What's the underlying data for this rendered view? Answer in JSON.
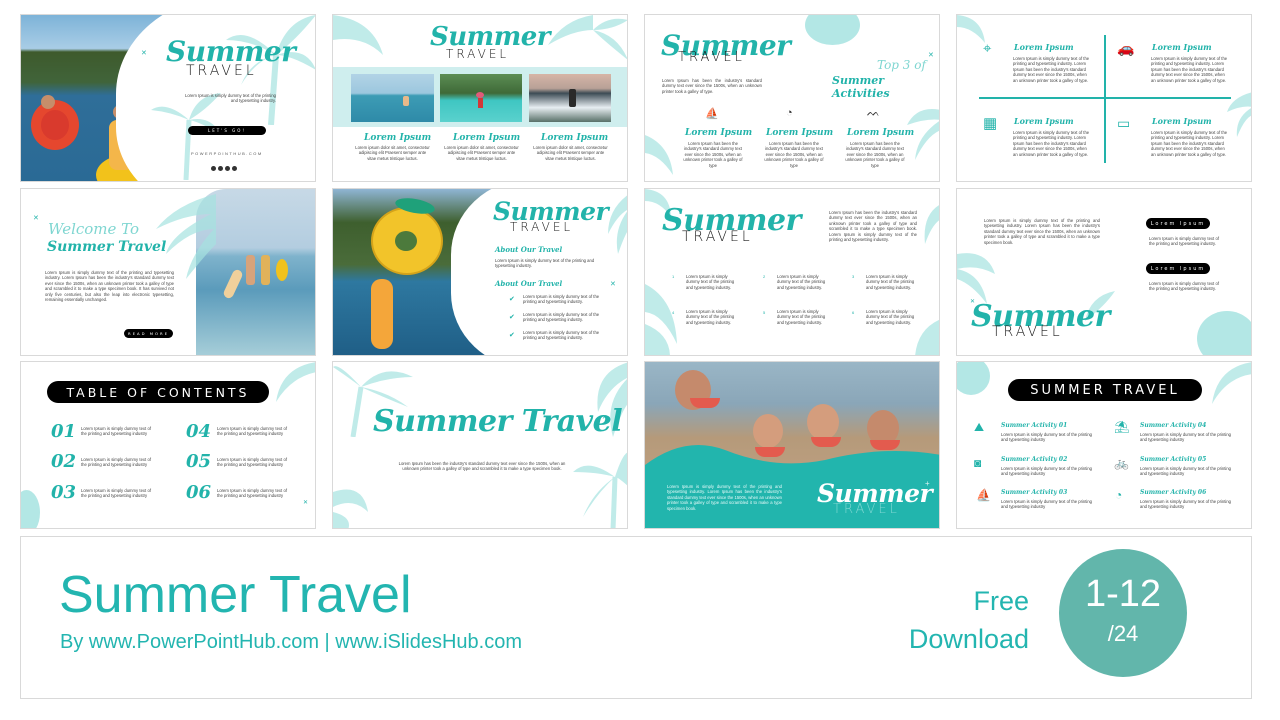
{
  "banner": {
    "title": "Summer Travel",
    "subtitle": "By www.PowerPointHub.com | www.iSlidesHub.com",
    "free_line1": "Free",
    "free_line2": "Download",
    "badge_range": "1-12",
    "badge_total": "/24"
  },
  "colors": {
    "accent": "#22b3aa",
    "badge": "#62b6ab",
    "leaf": "#a6e3e0",
    "pill": "#000000"
  },
  "slides": [
    {
      "script": "Summer",
      "travel": "TRAVEL",
      "desc": "Lorem Ipsum is simply dummy text of the printing and typesetting industry.",
      "button": "LET'S GO!",
      "website": "POWERPOINTHUB.COM",
      "social_icons": [
        "instagram-icon",
        "facebook-icon",
        "twitter-icon",
        "pinterest-icon"
      ]
    },
    {
      "script": "Summer",
      "travel": "TRAVEL",
      "cards": [
        {
          "title": "Lorem Ipsum",
          "text": "Lorem ipsum dolor sit amet, consectetur adipiscing elit Praesent semper ante vitae metus tristique luctus."
        },
        {
          "title": "Lorem Ipsum",
          "text": "Lorem ipsum dolor sit amet, consectetur adipiscing elit Praesent semper ante vitae metus tristique luctus."
        },
        {
          "title": "Lorem Ipsum",
          "text": "Lorem ipsum dolor sit amet, consectetur adipiscing elit Praesent semper ante vitae metus tristique luctus."
        }
      ]
    },
    {
      "script": "Summer",
      "travel": "TRAVEL",
      "intro": "Lorem Ipsum has been the industry's standard dummy text ever since the 1500s, when an unknown printer took a galley of type.",
      "heading1": "Top 3 of",
      "heading2": "Summer Activities",
      "items": [
        {
          "icon": "sailboat-icon",
          "title": "Lorem Ipsum",
          "text": "Lorem Ipsum has been the industry's standard dummy text ever since the 1500s, when an unknown printer took a galley of type"
        },
        {
          "icon": "snorkel-icon",
          "title": "Lorem Ipsum",
          "text": "Lorem Ipsum has been the industry's standard dummy text ever since the 1500s, when an unknown printer took a galley of type"
        },
        {
          "icon": "bikini-icon",
          "title": "Lorem Ipsum",
          "text": "Lorem Ipsum has been the industry's standard dummy text ever since the 1500s, when an unknown printer took a galley of type"
        }
      ]
    },
    {
      "quadrants": [
        {
          "icon": "location-pin-icon",
          "title": "Lorem Ipsum",
          "text": "Lorem Ipsum is simply dummy text of the printing and typesetting industry. Lorem Ipsum has been the industry's standard dummy text ever since the 1500s, when an unknown printer took a galley of type."
        },
        {
          "icon": "car-luggage-icon",
          "title": "Lorem Ipsum",
          "text": "Lorem Ipsum is simply dummy text of the printing and typesetting industry. Lorem Ipsum has been the industry's standard dummy text ever since the 1500s, when an unknown printer took a galley of type."
        },
        {
          "icon": "hotel-building-icon",
          "title": "Lorem Ipsum",
          "text": "Lorem Ipsum is simply dummy text of the printing and typesetting industry. Lorem Ipsum has been the industry's standard dummy text ever since the 1500s, when an unknown printer took a galley of type."
        },
        {
          "icon": "wallet-icon",
          "title": "Lorem Ipsum",
          "text": "Lorem Ipsum is simply dummy text of the printing and typesetting industry. Lorem Ipsum has been the industry's standard dummy text ever since the 1500s, when an unknown printer took a galley of type."
        }
      ]
    },
    {
      "heading1": "Welcome To",
      "heading2": "Summer Travel",
      "body": "Lorem Ipsum is simply dummy text of the printing and typesetting industry. Lorem Ipsum has been the industry's standard dummy text ever since the 1500s, when an unknown printer took a galley of type and scrambled it to make a type specimen book. It has survived not only five centuries, but also the leap into electronic typesetting, remaining essentially unchanged.",
      "button": "READ MORE"
    },
    {
      "script": "Summer",
      "travel": "TRAVEL",
      "section1": "About Our Travel",
      "section1_text": "Lorem Ipsum is simply dummy text of the printing and typesetting industry.",
      "section2": "About Our Travel",
      "checks": [
        "Lorem Ipsum is simply dummy text of the printing and typesetting industry.",
        "Lorem Ipsum is simply dummy text of the printing and typesetting industry.",
        "Lorem Ipsum is simply dummy text of the printing and typesetting industry."
      ]
    },
    {
      "script": "Summer",
      "travel": "TRAVEL",
      "intro": "Lorem Ipsum has been the industry's standard dummy text ever since the 1500s, when an unknown printer took a galley of type and scrambled it to make a type specimen book. Lorem Ipsum is simply dummy text of the printing and typesetting industry.",
      "items": [
        {
          "num": "1",
          "text": "Lorem Ipsum is simply dummy text of the printing and typesetting industry."
        },
        {
          "num": "2",
          "text": "Lorem Ipsum is simply dummy text of the printing and typesetting industry."
        },
        {
          "num": "3",
          "text": "Lorem Ipsum is simply dummy text of the printing and typesetting industry."
        },
        {
          "num": "4",
          "text": "Lorem Ipsum is simply dummy text of the printing and typesetting industry."
        },
        {
          "num": "5",
          "text": "Lorem Ipsum is simply dummy text of the printing and typesetting industry."
        },
        {
          "num": "6",
          "text": "Lorem Ipsum is simply dummy text of the printing and typesetting industry."
        }
      ]
    },
    {
      "intro": "Lorem Ipsum is simply dummy text of the printing and typesetting industry. Lorem Ipsum has been the industry's standard dummy text ever since the 1500s, when an unknown printer took a galley of type and scrambled it to make a type specimen book.",
      "pill1": "Lorem Ipsum",
      "pill1_text": "Lorem Ipsum is simply dummy text of the printing and typesetting industry.",
      "pill2": "Lorem Ipsum",
      "pill2_text": "Lorem Ipsum is simply dummy text of the printing and typesetting industry.",
      "script": "Summer",
      "travel": "TRAVEL"
    },
    {
      "heading": "TABLE OF CONTENTS",
      "items": [
        {
          "num": "01",
          "text": "Lorem Ipsum is simply dummy text of the printing and typesetting industry"
        },
        {
          "num": "02",
          "text": "Lorem Ipsum is simply dummy text of the printing and typesetting industry"
        },
        {
          "num": "03",
          "text": "Lorem Ipsum is simply dummy text of the printing and typesetting industry"
        },
        {
          "num": "04",
          "text": "Lorem Ipsum is simply dummy text of the printing and typesetting industry"
        },
        {
          "num": "05",
          "text": "Lorem Ipsum is simply dummy text of the printing and typesetting industry"
        },
        {
          "num": "06",
          "text": "Lorem Ipsum is simply dummy text of the printing and typesetting industry"
        }
      ]
    },
    {
      "title": "Summer Travel",
      "body": "Lorem Ipsum has been the industry's standard dummy text ever since the 1500s, when an unknown printer took a galley of type and scrambled it to make a type specimen book."
    },
    {
      "body": "Lorem Ipsum is simply dummy text of the printing and typesetting industry. Lorem Ipsum has been the industry's standard dummy text ever since the 1500s, when an unknown printer took a galley of type and scrambled it to make a type specimen book.",
      "script": "Summer",
      "travel": "TRAVEL"
    },
    {
      "heading": "SUMMER TRAVEL",
      "items": [
        {
          "icon": "mountain-sun-icon",
          "title": "Summer Activity 01",
          "text": "Lorem Ipsum is simply dummy text of the printing and typesetting industry"
        },
        {
          "icon": "camera-icon",
          "title": "Summer Activity 02",
          "text": "Lorem Ipsum is simply dummy text of the printing and typesetting industry"
        },
        {
          "icon": "sailboat-icon",
          "title": "Summer Activity 03",
          "text": "Lorem Ipsum is simply dummy text of the printing and typesetting industry"
        },
        {
          "icon": "beach-umbrella-icon",
          "title": "Summer Activity 04",
          "text": "Lorem Ipsum is simply dummy text of the printing and typesetting industry"
        },
        {
          "icon": "bicycle-icon",
          "title": "Summer Activity 05",
          "text": "Lorem Ipsum is simply dummy text of the printing and typesetting industry"
        },
        {
          "icon": "snorkel-icon",
          "title": "Summer Activity 06",
          "text": "Lorem Ipsum is simply dummy text of the printing and typesetting industry"
        }
      ]
    }
  ]
}
